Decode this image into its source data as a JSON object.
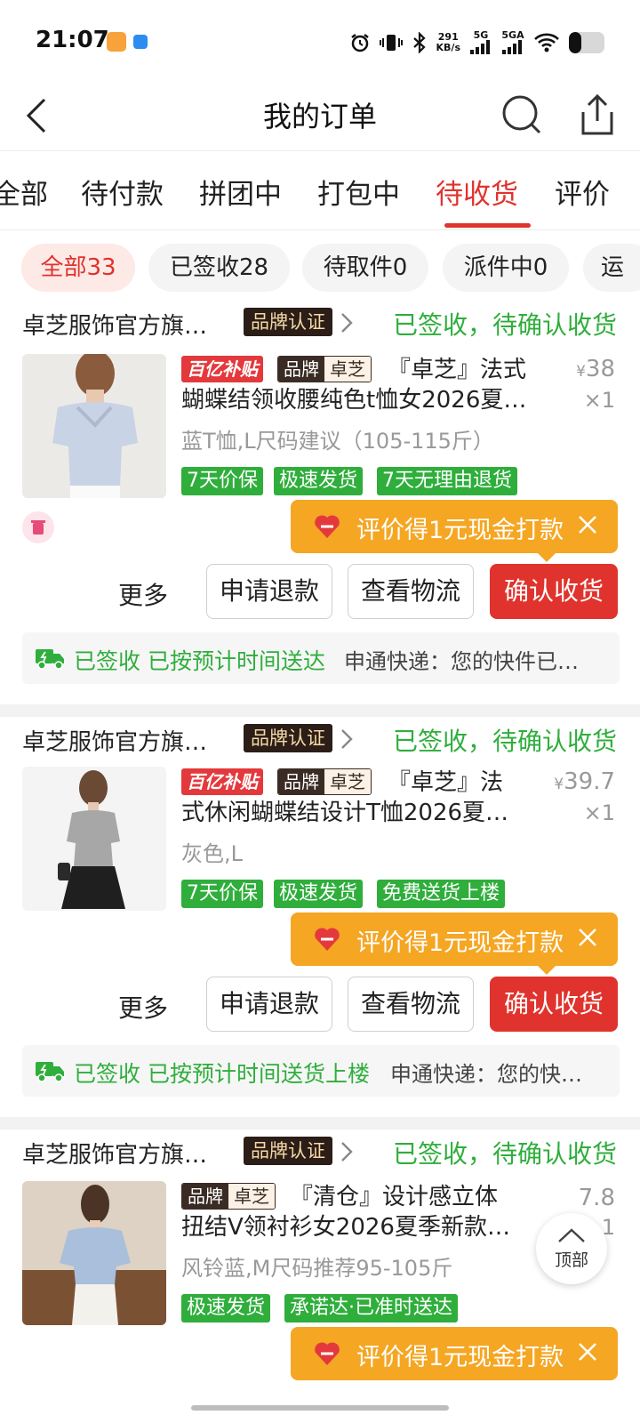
{
  "status_bar": {
    "time": "21:07",
    "net_speed_value": "291",
    "net_speed_unit": "KB/s",
    "sim1": "5G",
    "sim2": "5GA",
    "icons": [
      "alarm-icon",
      "vibrate-icon",
      "bluetooth-icon",
      "wifi-icon",
      "battery-icon"
    ],
    "battery_level": 0.35
  },
  "header": {
    "title": "我的订单",
    "back_icon": "chevron-left-icon",
    "search_icon": "search-icon",
    "share_icon": "share-icon"
  },
  "tabs": [
    {
      "label": "全部",
      "active": false
    },
    {
      "label": "待付款",
      "active": false
    },
    {
      "label": "拼团中",
      "active": false
    },
    {
      "label": "打包中",
      "active": false
    },
    {
      "label": "待收货",
      "active": true
    },
    {
      "label": "评价",
      "active": false
    }
  ],
  "chips": [
    {
      "label": "全部33",
      "active": true
    },
    {
      "label": "已签收28",
      "active": false
    },
    {
      "label": "待取件0",
      "active": false
    },
    {
      "label": "派件中0",
      "active": false
    },
    {
      "label": "运",
      "active": false
    }
  ],
  "orders": [
    {
      "store": "卓芝服饰官方旗…",
      "brand_cert": "品牌认证",
      "status": "已签收，待确认收货",
      "subsidy_tag": "百亿补贴",
      "brand_tag_a": "品牌",
      "brand_tag_b": "卓芝",
      "title_line1": "『卓芝』法式",
      "title_line2": "蝴蝶结领收腰纯色t恤女2026夏…",
      "spec": "蓝T恤,L尺码建议（105-115斤）",
      "price_symbol": "¥",
      "price": "38",
      "qty": "×1",
      "service_tags": [
        "7天价保",
        "极速发货",
        "7天无理由退货"
      ],
      "review_bubble": "评价得1元现金打款",
      "more": "更多",
      "btn_refund": "申请退款",
      "btn_logistics": "查看物流",
      "btn_confirm": "确认收货",
      "logistics_status": "已签收 已按预计时间送达",
      "logistics_detail": "申通快递：您的快件已…"
    },
    {
      "store": "卓芝服饰官方旗…",
      "brand_cert": "品牌认证",
      "status": "已签收，待确认收货",
      "subsidy_tag": "百亿补贴",
      "brand_tag_a": "品牌",
      "brand_tag_b": "卓芝",
      "title_line1": "『卓芝』法",
      "title_line2": "式休闲蝴蝶结设计T恤2026夏…",
      "spec": "灰色,L",
      "price_symbol": "¥",
      "price": "39.7",
      "qty": "×1",
      "service_tags": [
        "7天价保",
        "极速发货",
        "免费送货上楼"
      ],
      "review_bubble": "评价得1元现金打款",
      "more": "更多",
      "btn_refund": "申请退款",
      "btn_logistics": "查看物流",
      "btn_confirm": "确认收货",
      "logistics_status": "已签收 已按预计时间送货上楼",
      "logistics_detail": "申通快递：您的快…"
    },
    {
      "store": "卓芝服饰官方旗…",
      "brand_cert": "品牌认证",
      "status": "已签收，待确认收货",
      "brand_tag_a": "品牌",
      "brand_tag_b": "卓芝",
      "title_line1": "『清仓』设计感立体",
      "title_line2": "扭结V领衬衫女2026夏季新款…",
      "spec": "风铃蓝,M尺码推荐95-105斤",
      "price_partial": "7.8",
      "qty_partial": "1",
      "service_tags": [
        "极速发货",
        "承诺达·已准时送达"
      ],
      "review_bubble": "评价得1元现金打款"
    }
  ],
  "back_to_top": "顶部",
  "colors": {
    "accent_red": "#e0332d",
    "status_green": "#2fae3c",
    "bubble_orange": "#f5a623"
  }
}
